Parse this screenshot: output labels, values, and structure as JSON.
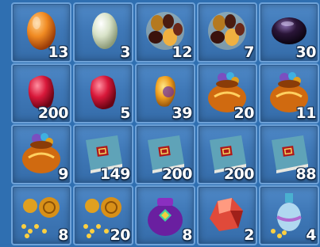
{
  "inventory": {
    "slots": [
      {
        "item": "orange-egg-gem",
        "quantity": "13"
      },
      {
        "item": "jade-egg-gem",
        "quantity": "3"
      },
      {
        "item": "mixed-gems",
        "quantity": "12"
      },
      {
        "item": "mixed-gems",
        "quantity": "7"
      },
      {
        "item": "dark-purple-gem",
        "quantity": "30"
      },
      {
        "item": "red-ruby-gem",
        "quantity": "200"
      },
      {
        "item": "red-ruby-gem",
        "quantity": "5"
      },
      {
        "item": "amber-gem",
        "quantity": "39"
      },
      {
        "item": "treasure-sack",
        "quantity": "20"
      },
      {
        "item": "treasure-sack",
        "quantity": "11"
      },
      {
        "item": "treasure-sack",
        "quantity": "9"
      },
      {
        "item": "skill-book",
        "quantity": "149"
      },
      {
        "item": "skill-book",
        "quantity": "200"
      },
      {
        "item": "skill-book",
        "quantity": "200"
      },
      {
        "item": "skill-book",
        "quantity": "88"
      },
      {
        "item": "gold-gourd-coins",
        "quantity": "8"
      },
      {
        "item": "gold-gourd-coins",
        "quantity": "20"
      },
      {
        "item": "purple-pouch",
        "quantity": "8"
      },
      {
        "item": "red-ore",
        "quantity": "2"
      },
      {
        "item": "vase-coins",
        "quantity": "4"
      }
    ]
  },
  "colors": {
    "background": "#2f6fb1",
    "slot_border": "#6ea2d8",
    "quantity_text": "#ffffff"
  }
}
